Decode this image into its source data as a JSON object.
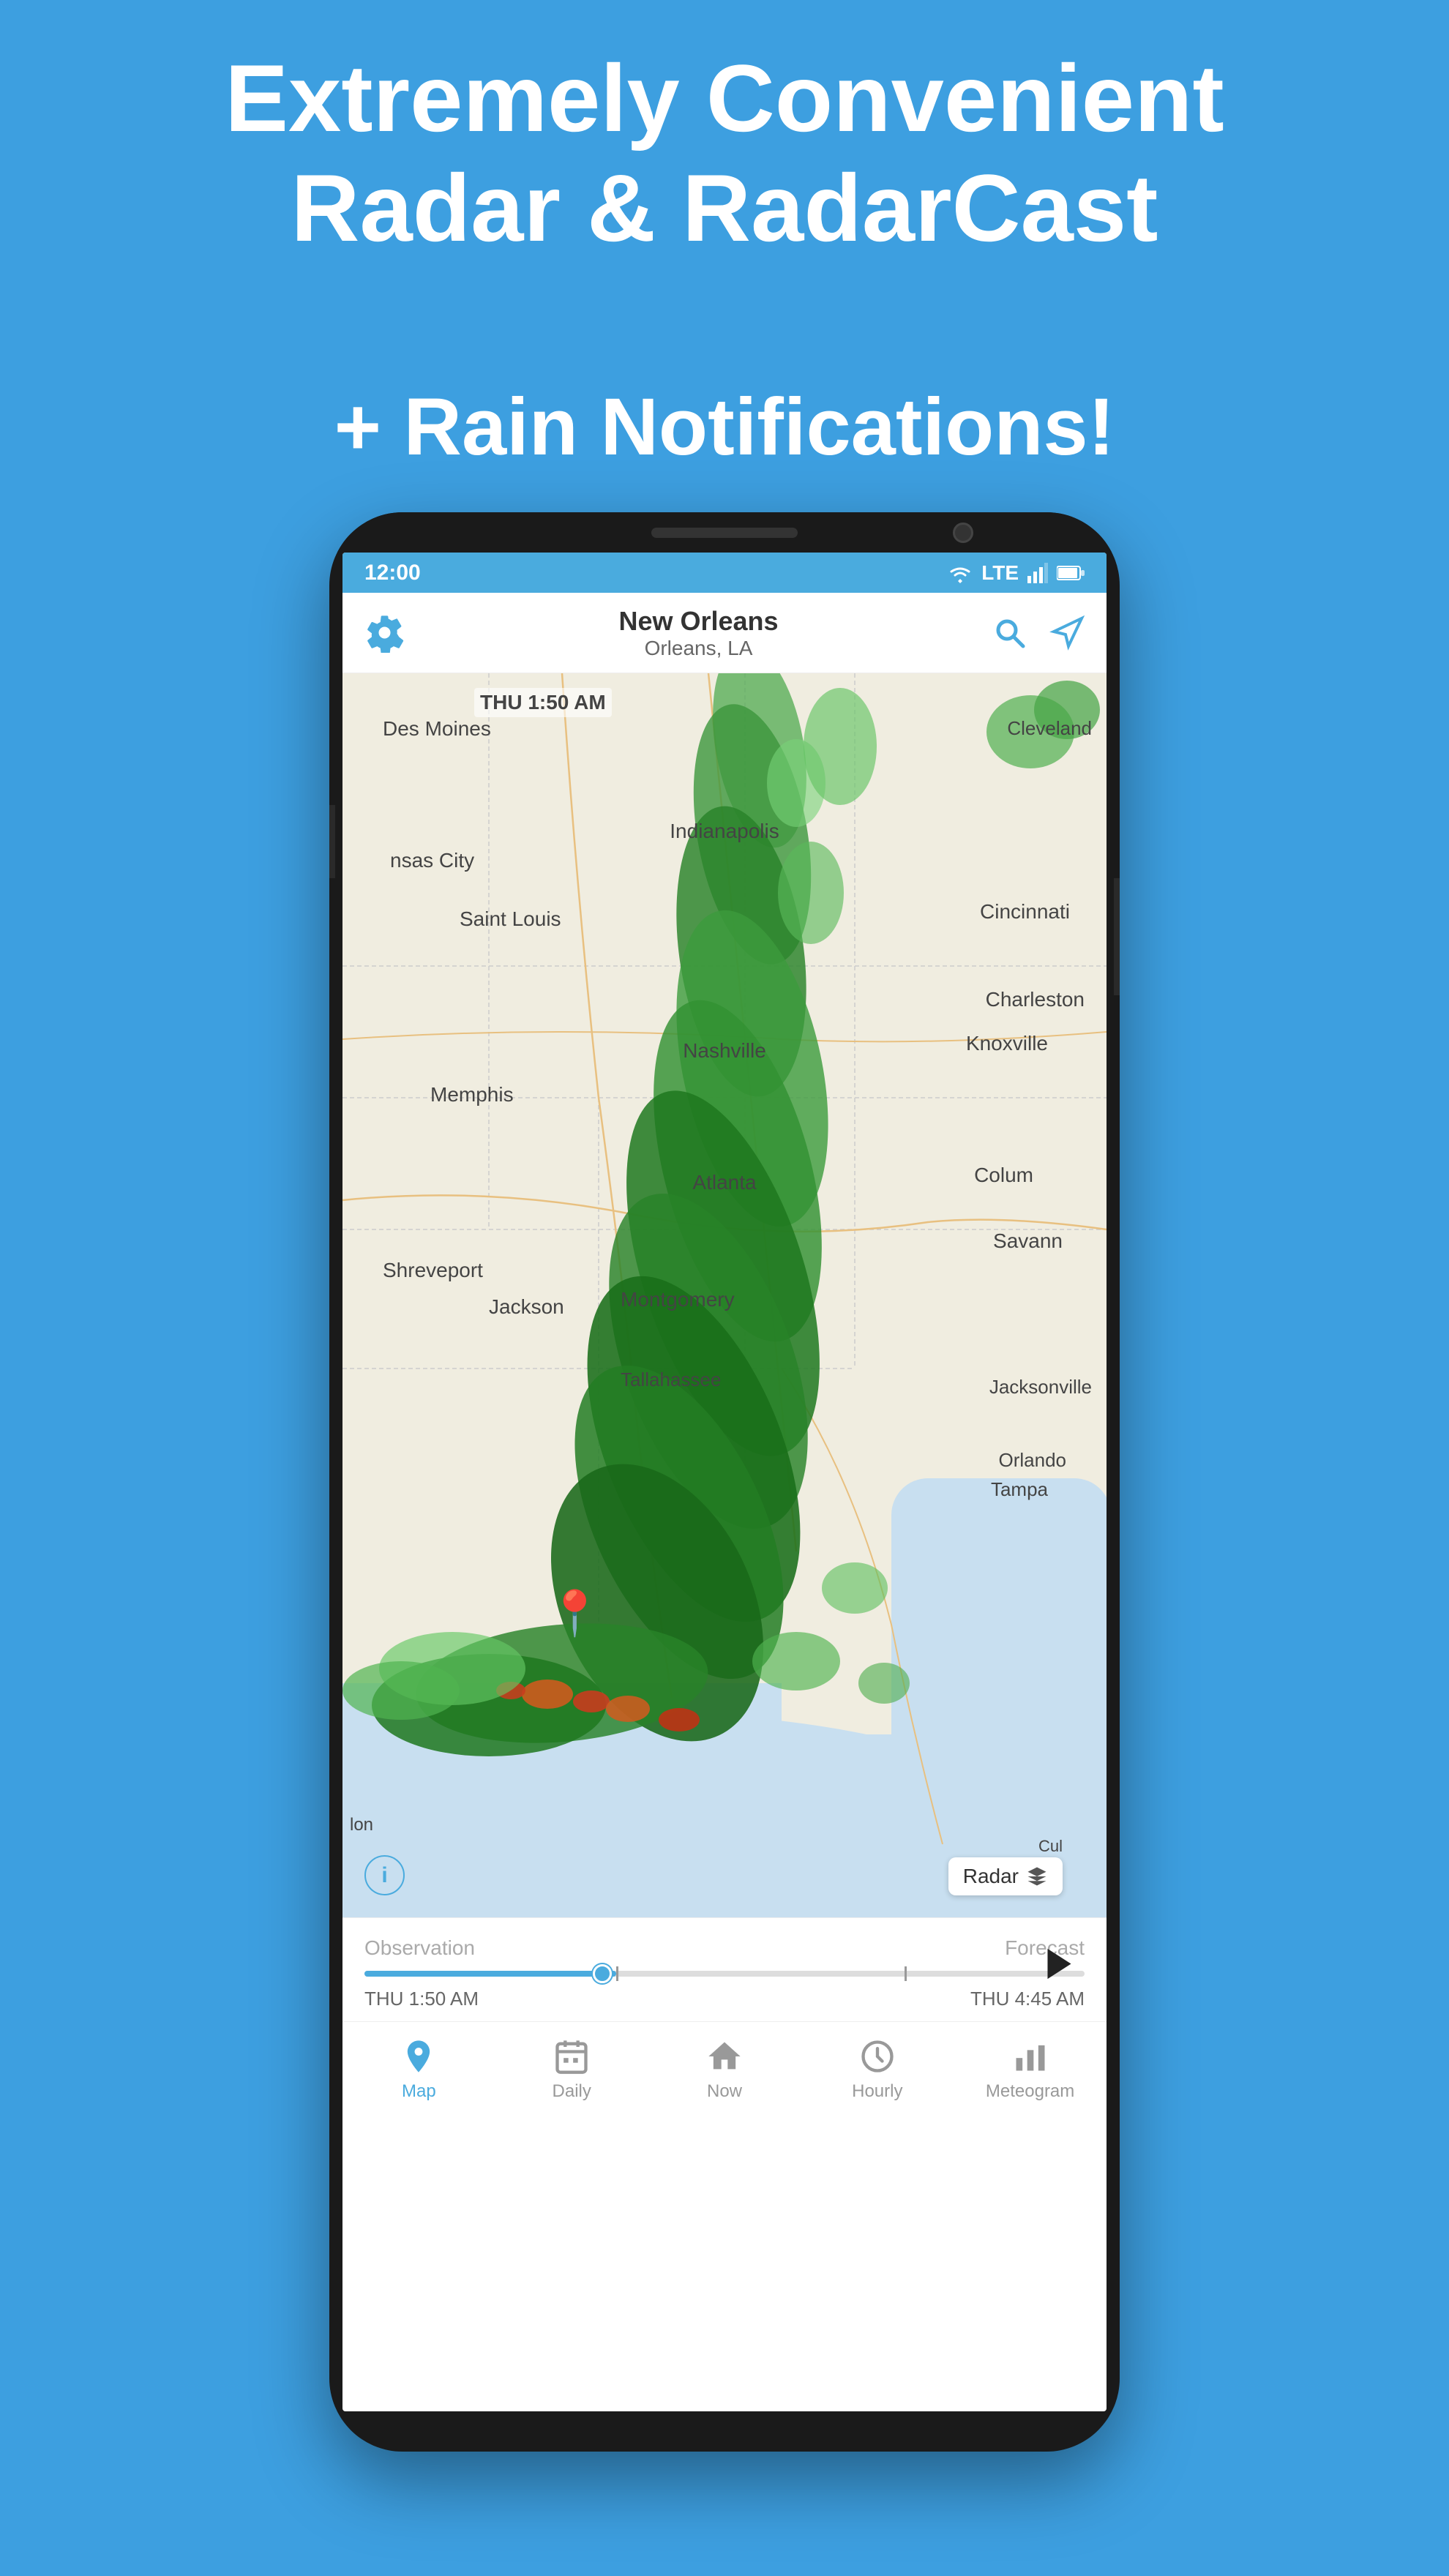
{
  "hero": {
    "title_line1": "Extremely Convenient",
    "title_line2": "Radar & RadarCast",
    "subtitle": "+ Rain Notifications!"
  },
  "status_bar": {
    "time": "12:00",
    "signal": "LTE"
  },
  "app_header": {
    "city": "New Orleans",
    "location": "Orleans, LA"
  },
  "map": {
    "timestamp": "THU  1:50 AM",
    "radar_label": "Radar"
  },
  "timeline": {
    "observation_label": "Observation",
    "forecast_label": "Forecast",
    "start_time": "THU 1:50 AM",
    "end_time": "THU 4:45 AM"
  },
  "bottom_nav": {
    "items": [
      {
        "id": "map",
        "label": "Map",
        "active": true
      },
      {
        "id": "daily",
        "label": "Daily",
        "active": false
      },
      {
        "id": "now",
        "label": "Now",
        "active": false
      },
      {
        "id": "hourly",
        "label": "Hourly",
        "active": false
      },
      {
        "id": "meteogram",
        "label": "Meteogram",
        "active": false
      }
    ]
  },
  "colors": {
    "accent": "#4aabde",
    "background": "#3d9fe0"
  }
}
